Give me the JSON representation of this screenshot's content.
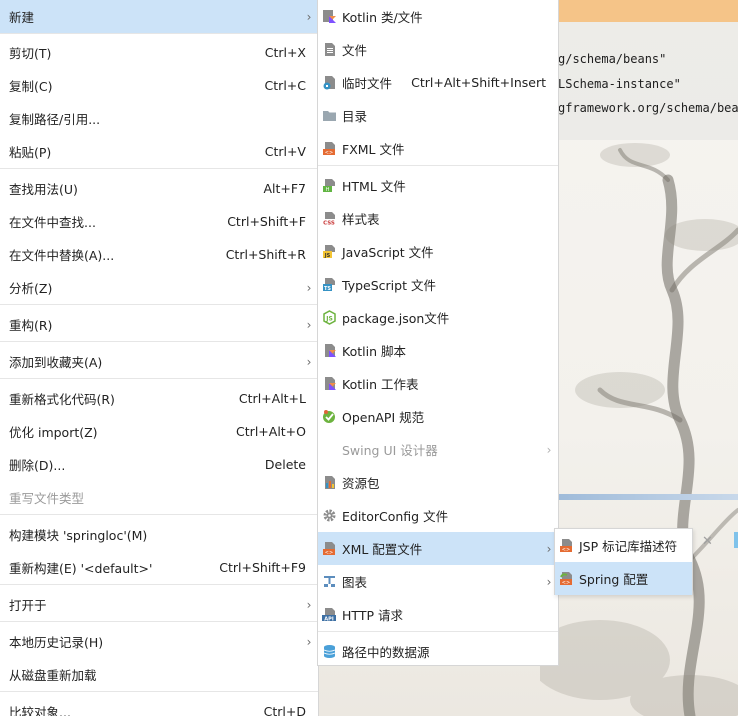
{
  "editor": {
    "code_lines": [
      "g/schema/beans\"",
      "LSchema-instance\"",
      "gframework.org/schema/bean"
    ]
  },
  "main_menu": {
    "items": [
      {
        "label": "新建",
        "shortcut": "",
        "submenu": true,
        "selected": true
      },
      {
        "label": "剪切(T)",
        "shortcut": "Ctrl+X"
      },
      {
        "label": "复制(C)",
        "shortcut": "Ctrl+C"
      },
      {
        "label": "复制路径/引用...",
        "shortcut": ""
      },
      {
        "label": "粘贴(P)",
        "shortcut": "Ctrl+V"
      },
      {
        "label": "查找用法(U)",
        "shortcut": "Alt+F7"
      },
      {
        "label": "在文件中查找...",
        "shortcut": "Ctrl+Shift+F"
      },
      {
        "label": "在文件中替换(A)...",
        "shortcut": "Ctrl+Shift+R"
      },
      {
        "label": "分析(Z)",
        "shortcut": "",
        "submenu": true
      },
      {
        "label": "重构(R)",
        "shortcut": "",
        "submenu": true
      },
      {
        "label": "添加到收藏夹(A)",
        "shortcut": "",
        "submenu": true
      },
      {
        "label": "重新格式化代码(R)",
        "shortcut": "Ctrl+Alt+L"
      },
      {
        "label": "优化 import(Z)",
        "shortcut": "Ctrl+Alt+O"
      },
      {
        "label": "删除(D)...",
        "shortcut": "Delete"
      },
      {
        "label": "重写文件类型",
        "shortcut": "",
        "disabled": true
      },
      {
        "label": "构建模块 'springloc'(M)",
        "shortcut": ""
      },
      {
        "label": "重新构建(E) '<default>'",
        "shortcut": "Ctrl+Shift+F9"
      },
      {
        "label": "打开于",
        "shortcut": "",
        "submenu": true
      },
      {
        "label": "本地历史记录(H)",
        "shortcut": "",
        "submenu": true
      },
      {
        "label": "从磁盘重新加载",
        "shortcut": ""
      },
      {
        "label": "比较对象...",
        "shortcut": "Ctrl+D"
      }
    ]
  },
  "new_menu": {
    "items": [
      {
        "label": "Kotlin 类/文件",
        "icon": "kotlin-icon"
      },
      {
        "label": "文件",
        "icon": "file-icon"
      },
      {
        "label": "临时文件",
        "shortcut": "Ctrl+Alt+Shift+Insert",
        "icon": "scratch-file-icon"
      },
      {
        "label": "目录",
        "icon": "folder-icon"
      },
      {
        "label": "FXML 文件",
        "icon": "fxml-icon"
      },
      {
        "label": "HTML 文件",
        "icon": "html-icon"
      },
      {
        "label": "样式表",
        "icon": "css-icon"
      },
      {
        "label": "JavaScript 文件",
        "icon": "javascript-icon"
      },
      {
        "label": "TypeScript 文件",
        "icon": "typescript-icon"
      },
      {
        "label": "package.json文件",
        "icon": "nodejs-icon"
      },
      {
        "label": "Kotlin 脚本",
        "icon": "kotlin-script-icon"
      },
      {
        "label": "Kotlin 工作表",
        "icon": "kotlin-worksheet-icon"
      },
      {
        "label": "OpenAPI 规范",
        "icon": "openapi-icon"
      },
      {
        "label": "Swing UI 设计器",
        "icon": "",
        "disabled": true,
        "submenu": true
      },
      {
        "label": "资源包",
        "icon": "resource-bundle-icon"
      },
      {
        "label": "EditorConfig 文件",
        "icon": "gear-icon"
      },
      {
        "label": "XML 配置文件",
        "icon": "xml-icon",
        "submenu": true,
        "selected": true
      },
      {
        "label": "图表",
        "icon": "diagram-icon",
        "submenu": true
      },
      {
        "label": "HTTP 请求",
        "icon": "api-icon"
      },
      {
        "label": "路径中的数据源",
        "icon": "database-icon"
      }
    ]
  },
  "xml_menu": {
    "items": [
      {
        "label": "JSP 标记库描述符",
        "icon": "xml-icon"
      },
      {
        "label": "Spring 配置",
        "icon": "spring-xml-icon",
        "selected": true
      }
    ]
  },
  "colors": {
    "selection": "#cce3f8",
    "menu_bg": "#ffffff",
    "disabled_text": "#9a9a9a",
    "editor_tab": "#f5c488",
    "kotlin": "#7f52ff",
    "xml_orange": "#e56b32",
    "spring_green": "#6db33f"
  }
}
